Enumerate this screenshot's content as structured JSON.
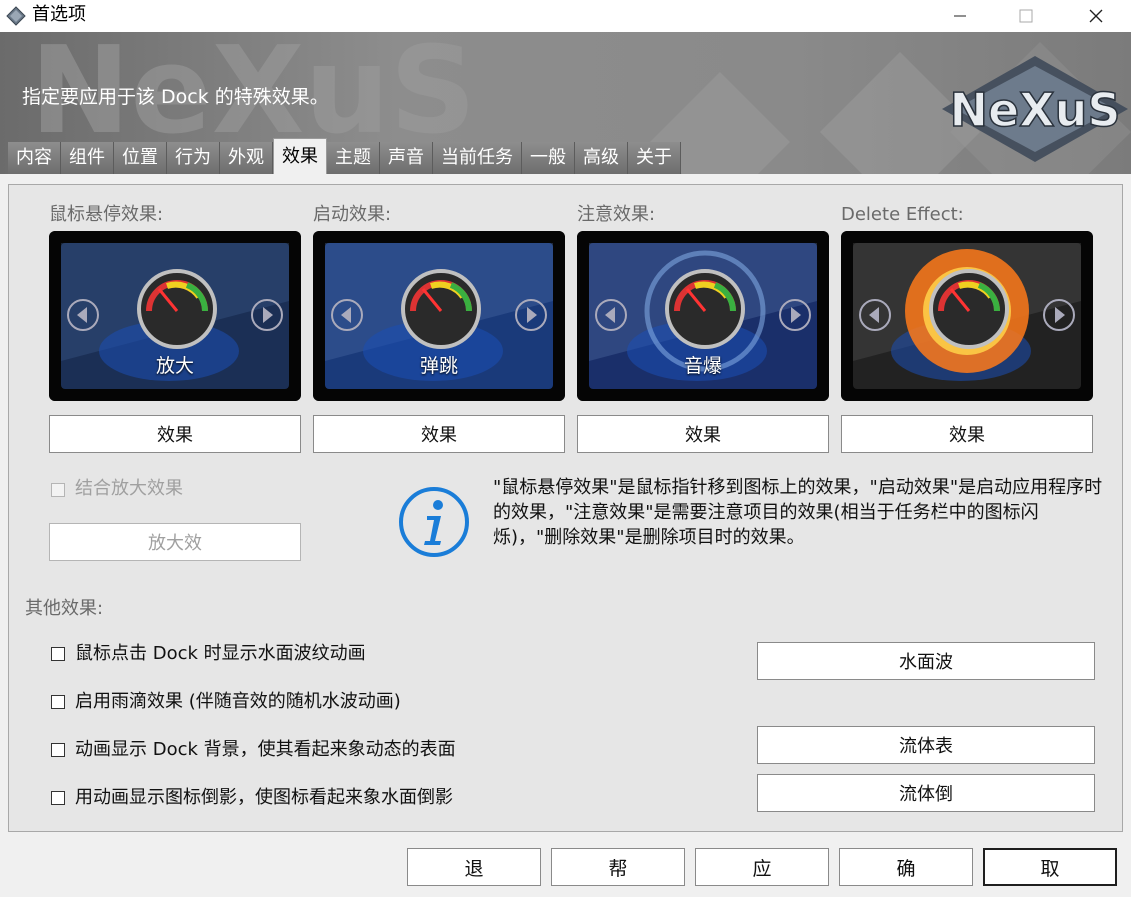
{
  "window": {
    "title": "首选项",
    "controls": [
      "minimize-icon",
      "maximize-icon",
      "close-icon"
    ]
  },
  "header": {
    "description": "指定要应用于该 Dock 的特殊效果。",
    "logo_text": "NeXuS"
  },
  "tabs": [
    {
      "label": "内容"
    },
    {
      "label": "组件"
    },
    {
      "label": "位置"
    },
    {
      "label": "行为"
    },
    {
      "label": "外观"
    },
    {
      "label": "效果",
      "active": true
    },
    {
      "label": "主题"
    },
    {
      "label": "声音"
    },
    {
      "label": "当前任务"
    },
    {
      "label": "一般"
    },
    {
      "label": "高级"
    },
    {
      "label": "关于"
    }
  ],
  "effects": [
    {
      "title": "鼠标悬停效果:",
      "preview_label": "放大",
      "button": "效果"
    },
    {
      "title": "启动效果:",
      "preview_label": "弹跳",
      "button": "效果"
    },
    {
      "title": "注意效果:",
      "preview_label": "音爆",
      "button": "效果"
    },
    {
      "title": "Delete Effect:",
      "preview_label": "",
      "button": "效果"
    }
  ],
  "combine_zoom": {
    "label": "结合放大效果",
    "checked": false,
    "enabled": false
  },
  "zoom_button": {
    "label": "放大效",
    "enabled": false
  },
  "info": {
    "icon": "info-icon",
    "text": "\"鼠标悬停效果\"是鼠标指针移到图标上的效果，\"启动效果\"是启动应用程序时的效果，\"注意效果\"是需要注意项目的效果(相当于任务栏中的图标闪烁)，\"删除效果\"是删除项目时的效果。"
  },
  "other": {
    "title": "其他效果:",
    "options": [
      {
        "label": "鼠标点击 Dock 时显示水面波纹动画",
        "checked": false
      },
      {
        "label": "启用雨滴效果 (伴随音效的随机水波动画)",
        "checked": false
      },
      {
        "label": "动画显示 Dock 背景，使其看起来象动态的表面",
        "checked": false
      },
      {
        "label": "用动画显示图标倒影，使图标看起来象水面倒影",
        "checked": false
      }
    ],
    "buttons": {
      "ripple": "水面波",
      "fluid_surface": "流体表",
      "fluid_reflection": "流体倒"
    }
  },
  "footer": {
    "buttons": [
      "退",
      "帮",
      "应",
      "确",
      "取"
    ]
  },
  "colors": {
    "accent_info": "#1a7dd8",
    "header_gray": "#8a8a8a"
  }
}
